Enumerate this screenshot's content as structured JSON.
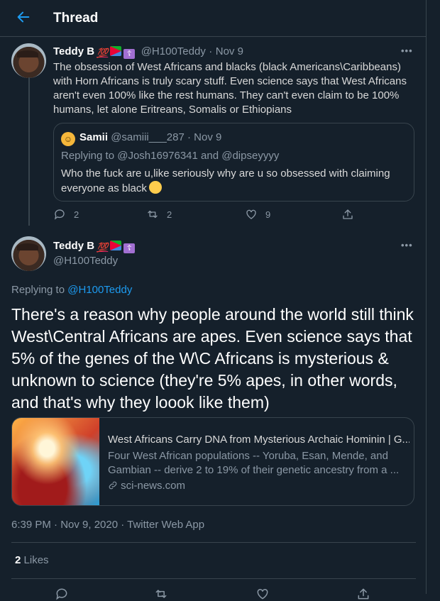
{
  "header": {
    "title": "Thread"
  },
  "tweet1": {
    "name": "Teddy B",
    "badge": "💯",
    "handle": "@H100Teddy",
    "date": "Nov 9",
    "text": "The obsession of West Africans and blacks (black Americans\\Caribbeans) with Horn Africans is truly scary stuff. Even science says that West Africans aren't even 100% like the rest humans. They can't even claim to be 100% humans, let alone Eritreans, Somalis or Ethiopians",
    "quote": {
      "name": "Samii",
      "handle": "@samiii___287",
      "date": "Nov 9",
      "replying_label": "Replying to",
      "replying_to": "@Josh16976341 and @dipseyyyy",
      "text": "Who the fuck are u,like seriously why are u so obsessed with claiming everyone as black"
    },
    "actions": {
      "replies": "2",
      "retweets": "2",
      "likes": "9"
    }
  },
  "tweet2": {
    "name": "Teddy B",
    "badge": "💯",
    "handle": "@H100Teddy",
    "replying_label": "Replying to",
    "replying_to": "@H100Teddy",
    "text": "There's a reason why people around the world still think West\\Central Africans are apes. Even science says that 5% of the genes of the W\\C Africans is mysterious & unknown to science (they're 5% apes, in other words, and that's why they loook like them)",
    "card": {
      "title": "West Africans Carry DNA from Mysterious Archaic Hominin | G...",
      "description": "Four West African populations -- Yoruba, Esan, Mende, and Gambian -- derive 2 to 19% of their genetic ancestry from a ...",
      "domain": "sci-news.com"
    },
    "timestamp": "6:39 PM · Nov 9, 2020 · Twitter Web App",
    "likes_count": "2",
    "likes_label": "Likes"
  },
  "colors": {
    "background": "#15202b",
    "accent": "#1d9bf0",
    "muted": "#8b98a5",
    "border": "#38444d"
  },
  "icons": [
    "back-arrow-icon",
    "reply-icon",
    "retweet-icon",
    "like-icon",
    "share-icon",
    "more-icon",
    "link-icon"
  ]
}
